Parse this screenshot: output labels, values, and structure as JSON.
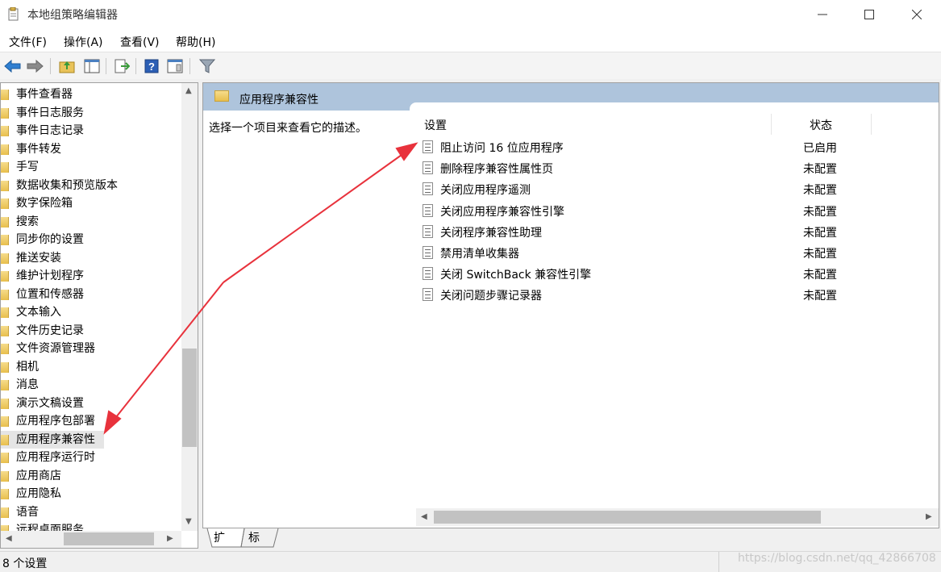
{
  "window": {
    "title": "本地组策略编辑器",
    "controls": {
      "minimize": "—",
      "maximize": "☐",
      "close": "✕"
    }
  },
  "menu": [
    {
      "label": "文件(F)"
    },
    {
      "label": "操作(A)"
    },
    {
      "label": "查看(V)"
    },
    {
      "label": "帮助(H)"
    }
  ],
  "toolbar": {
    "back_icon": "back-arrow-icon",
    "forward_icon": "forward-arrow-icon",
    "up_icon": "folder-up-icon",
    "show_hide_icon": "show-hide-tree-icon",
    "export_icon": "export-list-icon",
    "help_icon": "help-icon",
    "properties_icon": "properties-icon",
    "filter_icon": "filter-icon",
    "help_label": "?"
  },
  "tree": {
    "items": [
      {
        "label": "事件查看器"
      },
      {
        "label": "事件日志服务"
      },
      {
        "label": "事件日志记录"
      },
      {
        "label": "事件转发"
      },
      {
        "label": "手写"
      },
      {
        "label": "数据收集和预览版本"
      },
      {
        "label": "数字保险箱"
      },
      {
        "label": "搜索"
      },
      {
        "label": "同步你的设置"
      },
      {
        "label": "推送安装"
      },
      {
        "label": "维护计划程序"
      },
      {
        "label": "位置和传感器"
      },
      {
        "label": "文本输入"
      },
      {
        "label": "文件历史记录"
      },
      {
        "label": "文件资源管理器"
      },
      {
        "label": "相机"
      },
      {
        "label": "消息"
      },
      {
        "label": "演示文稿设置"
      },
      {
        "label": "应用程序包部署"
      },
      {
        "label": "应用程序兼容性"
      },
      {
        "label": "应用程序运行时"
      },
      {
        "label": "应用商店"
      },
      {
        "label": "应用隐私"
      },
      {
        "label": "语音"
      },
      {
        "label": "远程桌面服务"
      }
    ],
    "selected_index": 19
  },
  "detail": {
    "header_title": "应用程序兼容性",
    "description": "选择一个项目来查看它的描述。",
    "columns": {
      "setting": "设置",
      "state": "状态"
    },
    "rows": [
      {
        "name": "阻止访问 16 位应用程序",
        "state": "已启用"
      },
      {
        "name": "删除程序兼容性属性页",
        "state": "未配置"
      },
      {
        "name": "关闭应用程序遥测",
        "state": "未配置"
      },
      {
        "name": "关闭应用程序兼容性引擎",
        "state": "未配置"
      },
      {
        "name": "关闭程序兼容性助理",
        "state": "未配置"
      },
      {
        "name": "禁用清单收集器",
        "state": "未配置"
      },
      {
        "name": "关闭 SwitchBack 兼容性引擎",
        "state": "未配置"
      },
      {
        "name": "关闭问题步骤记录器",
        "state": "未配置"
      }
    ]
  },
  "tabs": [
    {
      "label": "扩展"
    },
    {
      "label": "标准"
    }
  ],
  "status": {
    "text": "8 个设置",
    "watermark": "https://blog.csdn.net/qq_42866708"
  },
  "colors": {
    "header_band": "#aec4dc",
    "annotation_arrow": "#e8323c",
    "selection": "#e5e5e5"
  }
}
